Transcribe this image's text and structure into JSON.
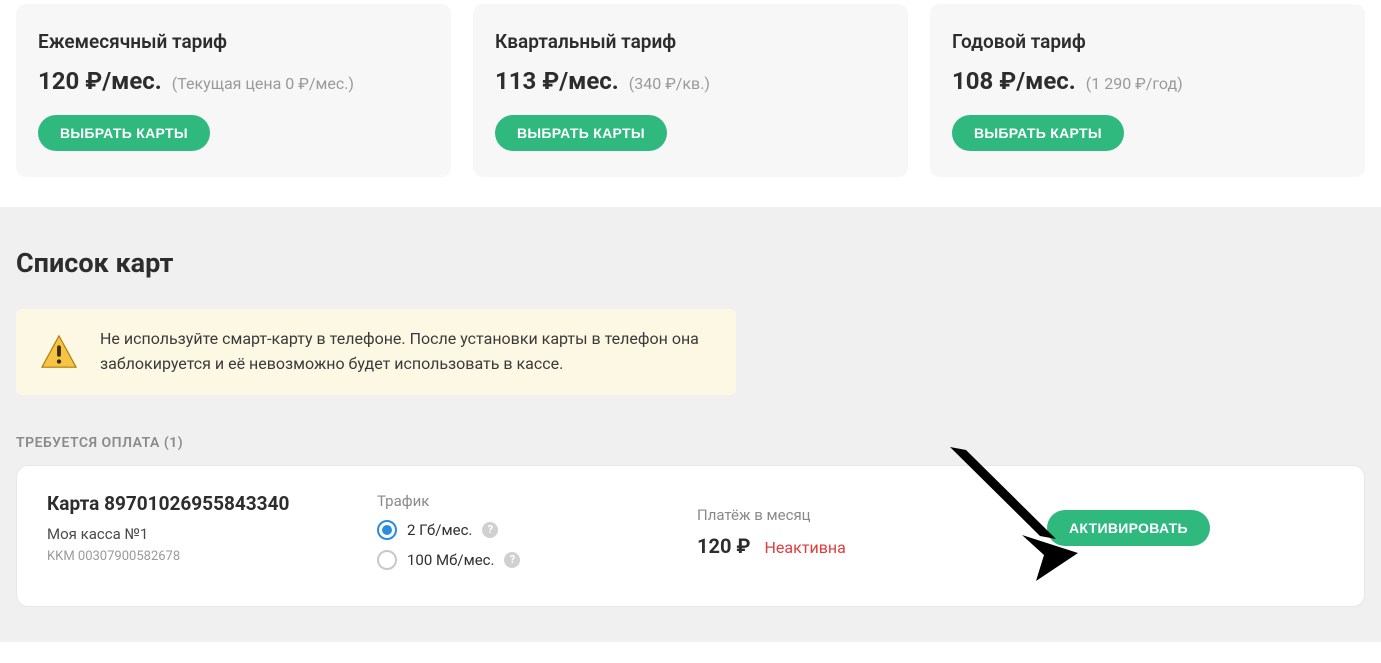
{
  "tariffs": [
    {
      "title": "Ежемесячный тариф",
      "price": "120 ₽/мес.",
      "note": "(Текущая цена 0 ₽/мес.)",
      "button": "ВЫБРАТЬ КАРТЫ"
    },
    {
      "title": "Квартальный тариф",
      "price": "113 ₽/мес.",
      "note": "(340 ₽/кв.)",
      "button": "ВЫБРАТЬ КАРТЫ"
    },
    {
      "title": "Годовой тариф",
      "price": "108 ₽/мес.",
      "note": "(1 290 ₽/год)",
      "button": "ВЫБРАТЬ КАРТЫ"
    }
  ],
  "section": {
    "title": "Список карт",
    "warning": "Не используйте смарт-карту в телефоне. После установки карты в телефон она заблокируется и её невозможно будет использовать в кассе.",
    "payment_required_label": "ТРЕБУЕТСЯ ОПЛАТА (1)"
  },
  "card": {
    "name": "Карта 89701026955843340",
    "cashbox": "Моя касса №1",
    "kkm": "KKM 00307900582678",
    "traffic_label": "Трафик",
    "options": {
      "opt1": "2 Гб/мес.",
      "opt2": "100 Мб/мес."
    },
    "help_glyph": "?",
    "payment_label": "Платёж в месяц",
    "payment_value": "120 ₽",
    "status": "Неактивна",
    "activate_button": "АКТИВИРОВАТЬ"
  }
}
